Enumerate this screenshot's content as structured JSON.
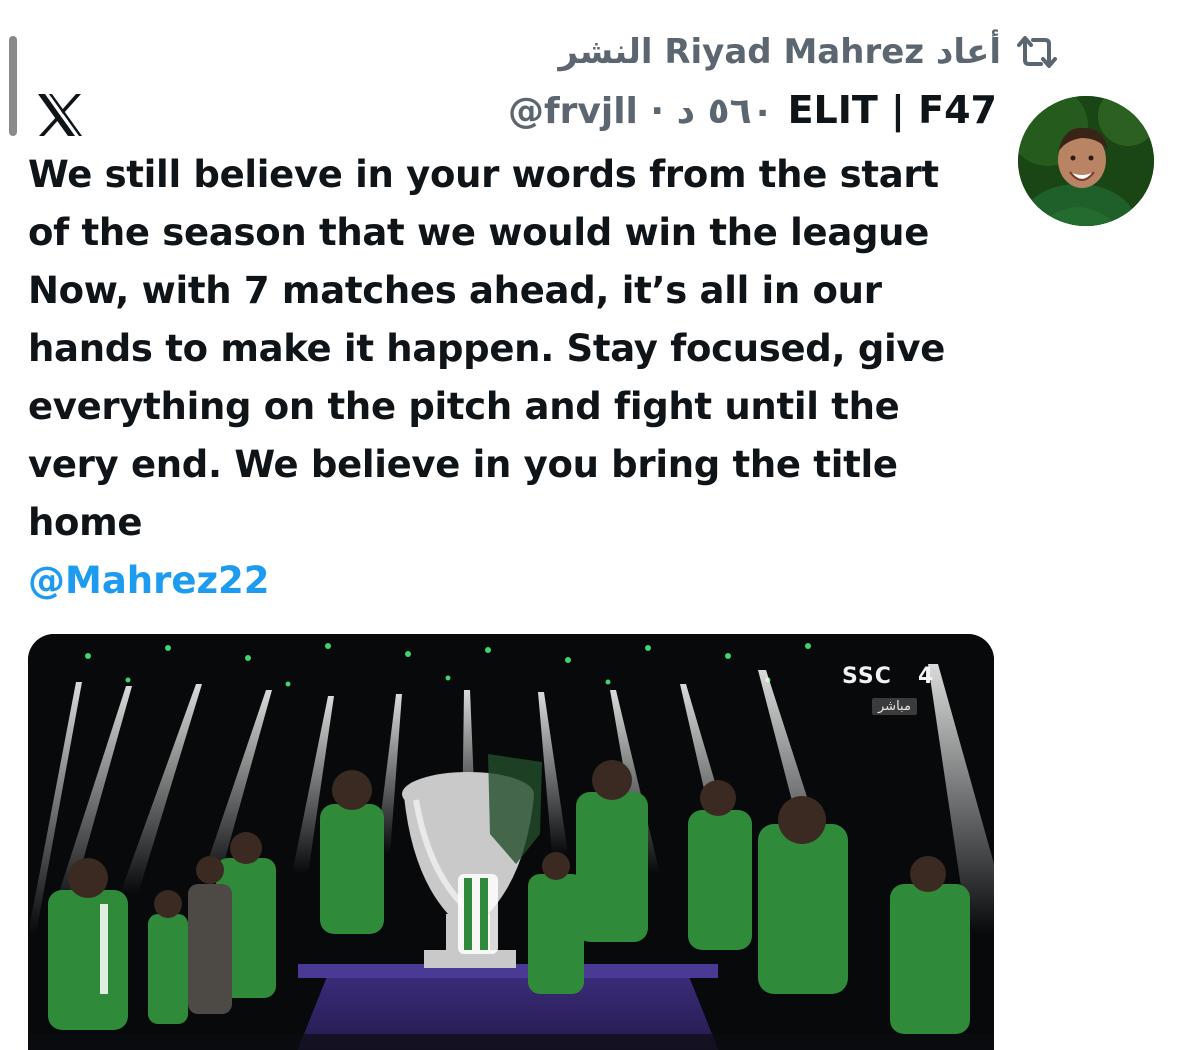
{
  "repost": {
    "text": "أعاد Riyad Mahrez النشر",
    "icon": "repost-icon"
  },
  "author": {
    "display_name": "ELIT | F47",
    "handle_time": "@frvjll · ٥٦٠ د"
  },
  "tweet": {
    "lines": [
      "We still believe in your words from the start",
      "of the season that we would win the league",
      "Now, with 7 matches ahead, it’s all in our",
      "hands to make it happen. Stay focused, give",
      "everything on the pitch and fight until the",
      "very end. We believe in you bring the title",
      "home"
    ],
    "mention": "@Mahrez22"
  },
  "media": {
    "channel_logo": "SSC",
    "channel_number": "4",
    "live_label": "مباشر"
  },
  "colors": {
    "text": "#0f1419",
    "secondary": "#5b6670",
    "link": "#1d9bf0",
    "kit_green": "#2f8a3a"
  }
}
